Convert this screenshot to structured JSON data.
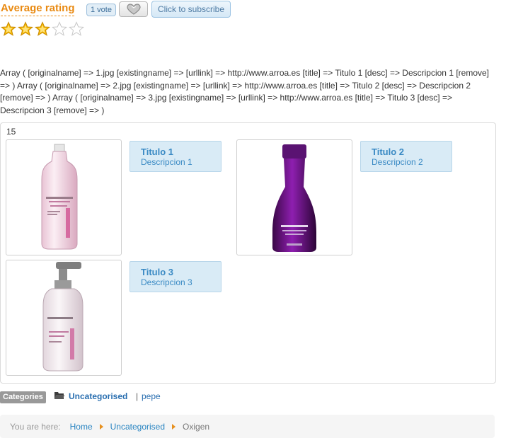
{
  "rating": {
    "title": "Average rating",
    "votes_label": "1 vote",
    "subscribe_label": "Click to subscribe",
    "stars_filled": 3,
    "stars_total": 5,
    "star_color": "#f5b800"
  },
  "debug_text": "Array ( [originalname] => 1.jpg [existingname] => [urllink] => http://www.arroa.es [title] => Titulo 1 [desc] => Descripcion 1 [remove] => ) Array ( [originalname] => 2.jpg [existingname] => [urllink] => http://www.arroa.es [title] => Titulo 2 [desc] => Descripcion 2 [remove] => ) Array ( [originalname] => 3.jpg [existingname] => [urllink] => http://www.arroa.es [title] => Titulo 3 [desc] => Descripcion 3 [remove] => )",
  "gallery": {
    "count": "15",
    "items": [
      {
        "title": "Titulo 1",
        "desc": "Descripcion 1",
        "product": "pink-bottle"
      },
      {
        "title": "Titulo 2",
        "desc": "Descripcion 2",
        "product": "purple-bottle"
      },
      {
        "title": "Titulo 3",
        "desc": "Descripcion 3",
        "product": "pump-bottle"
      }
    ]
  },
  "categories": {
    "label": "Categories",
    "main": "Uncategorised",
    "separator": "|",
    "sub": "pepe"
  },
  "breadcrumb": {
    "label": "You are here:",
    "items": [
      "Home",
      "Uncategorised",
      "Oxigen"
    ]
  },
  "colors": {
    "accent_orange": "#e98a12",
    "link_blue": "#2a85c2",
    "caption_bg": "#d9ebf6"
  }
}
